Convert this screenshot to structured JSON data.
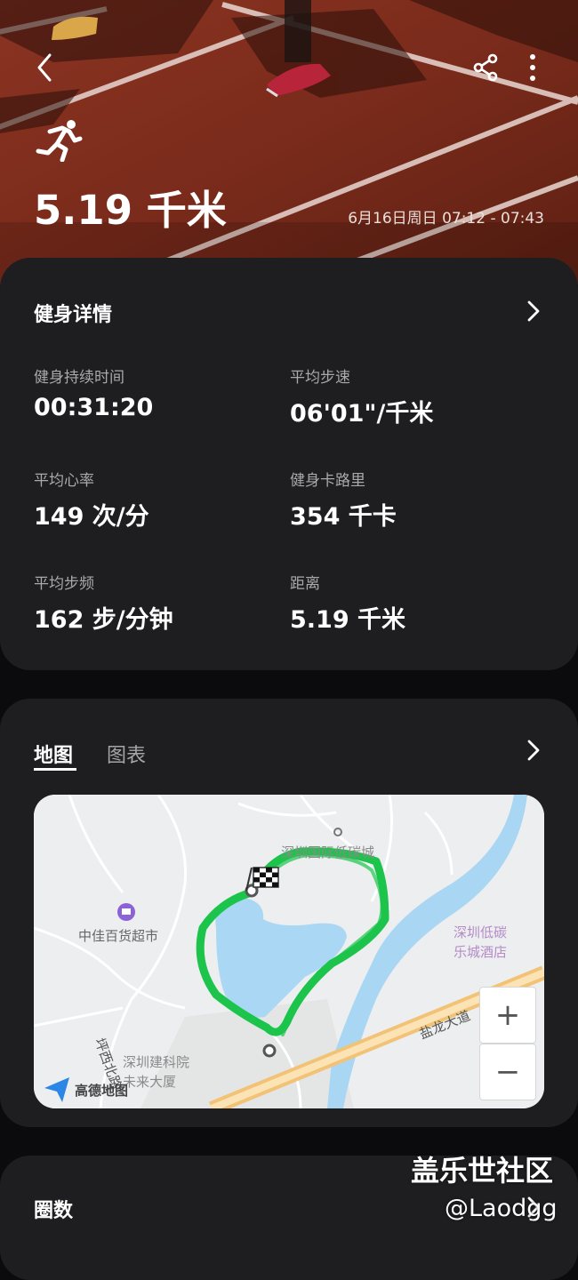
{
  "hero": {
    "distance": "5.19 千米",
    "datetime": "6月16日周日 07:12 - 07:43"
  },
  "details": {
    "title": "健身详情",
    "stats": [
      {
        "label": "健身持续时间",
        "value": "00:31:20"
      },
      {
        "label": "平均步速",
        "value": "06'01\"/千米"
      },
      {
        "label": "平均心率",
        "value": "149 次/分"
      },
      {
        "label": "健身卡路里",
        "value": "354 千卡"
      },
      {
        "label": "平均步频",
        "value": "162 步/分钟"
      },
      {
        "label": "距离",
        "value": "5.19 千米"
      }
    ]
  },
  "map_card": {
    "tabs": [
      "地图",
      "图表"
    ],
    "active_tab": 0,
    "map": {
      "labels": {
        "poi1": "深圳国际低碳城",
        "poi2": "中佳百货超市",
        "poi3a": "深圳低碳",
        "poi3b": "乐城酒店",
        "poi4a": "深圳建科院",
        "poi4b": "未来大厦",
        "road1": "盐龙大道",
        "road2": "坪西北路"
      },
      "brand": "高德地图",
      "zoom_in": "+",
      "zoom_out": "−",
      "route_color": "#1cc44b"
    }
  },
  "laps": {
    "title": "圈数"
  },
  "watermark": {
    "line1": "盖乐世社区",
    "line2": "@Laodgg"
  },
  "colors": {
    "card_bg": "#1e1e20",
    "page_bg": "#0b0b0d",
    "track": "#7a2c1e"
  }
}
